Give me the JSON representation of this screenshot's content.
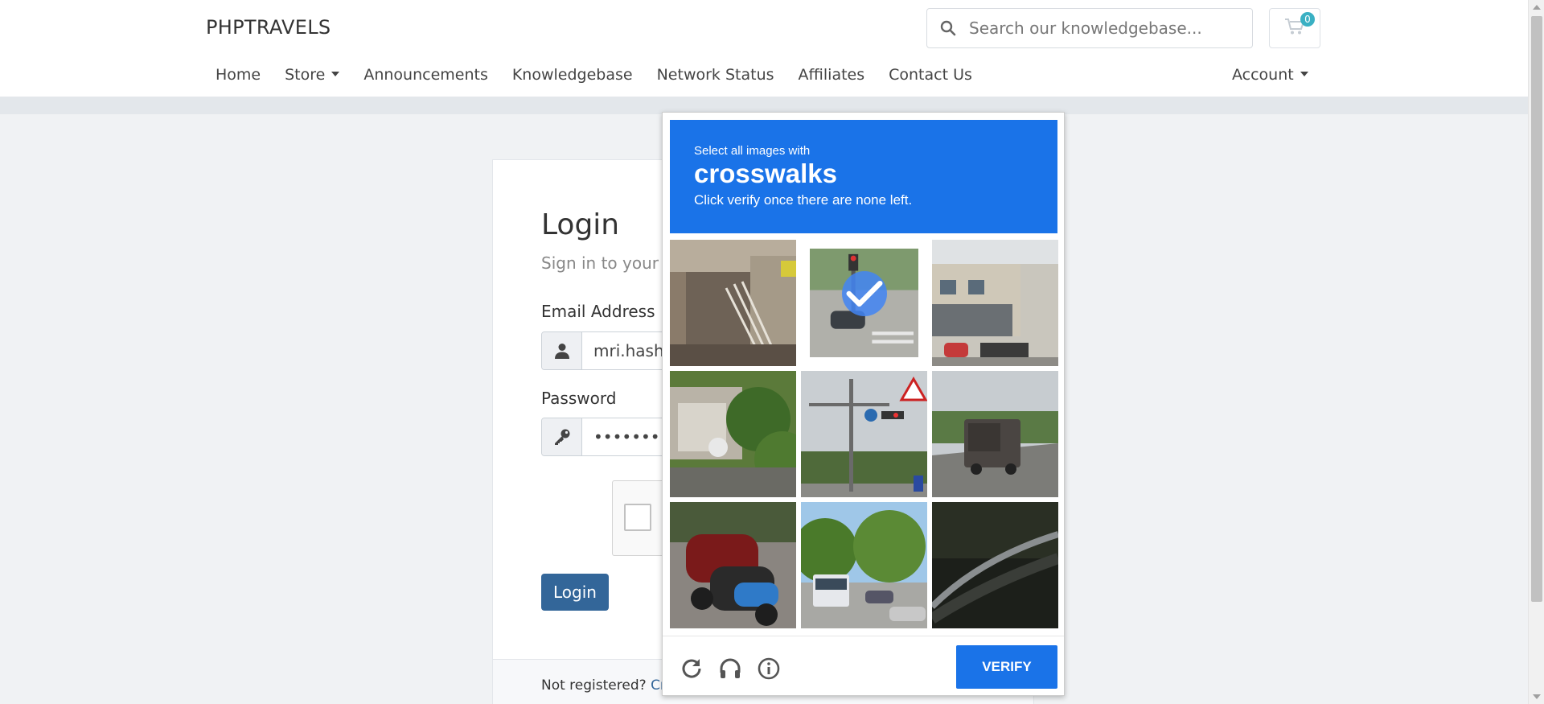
{
  "header": {
    "brand": "PHPTRAVELS",
    "search_placeholder": "Search our knowledgebase...",
    "cart_count": "0",
    "nav": [
      {
        "label": "Home"
      },
      {
        "label": "Store",
        "dropdown": true
      },
      {
        "label": "Announcements"
      },
      {
        "label": "Knowledgebase"
      },
      {
        "label": "Network Status"
      },
      {
        "label": "Affiliates"
      },
      {
        "label": "Contact Us"
      }
    ],
    "account_label": "Account"
  },
  "login": {
    "title": "Login",
    "subtitle": "Sign in to your a",
    "email_label": "Email Address",
    "email_value": "mri.hashn",
    "password_label": "Password",
    "password_value": "•••••••••••",
    "submit_label": "Login",
    "footer_text": "Not registered?",
    "footer_link": "Crea"
  },
  "captcha": {
    "instruction_line1": "Select all images with",
    "target": "crosswalks",
    "instruction_line2": "Click verify once there are none left.",
    "verify_label": "VERIFY",
    "tiles": [
      {
        "icon": "building-stairs-image",
        "selected": false
      },
      {
        "icon": "intersection-car-image",
        "selected": true
      },
      {
        "icon": "storefront-street-image",
        "selected": false
      },
      {
        "icon": "garage-scooter-image",
        "selected": false
      },
      {
        "icon": "traffic-lights-image",
        "selected": false
      },
      {
        "icon": "road-truck-image",
        "selected": false
      },
      {
        "icon": "parked-motorbikes-image",
        "selected": false
      },
      {
        "icon": "street-bus-image",
        "selected": false
      },
      {
        "icon": "dark-guardrail-image",
        "selected": false
      }
    ]
  },
  "colors": {
    "captcha_blue": "#1a73e8",
    "login_button": "#336699",
    "cart_badge": "#3ab0c3"
  }
}
